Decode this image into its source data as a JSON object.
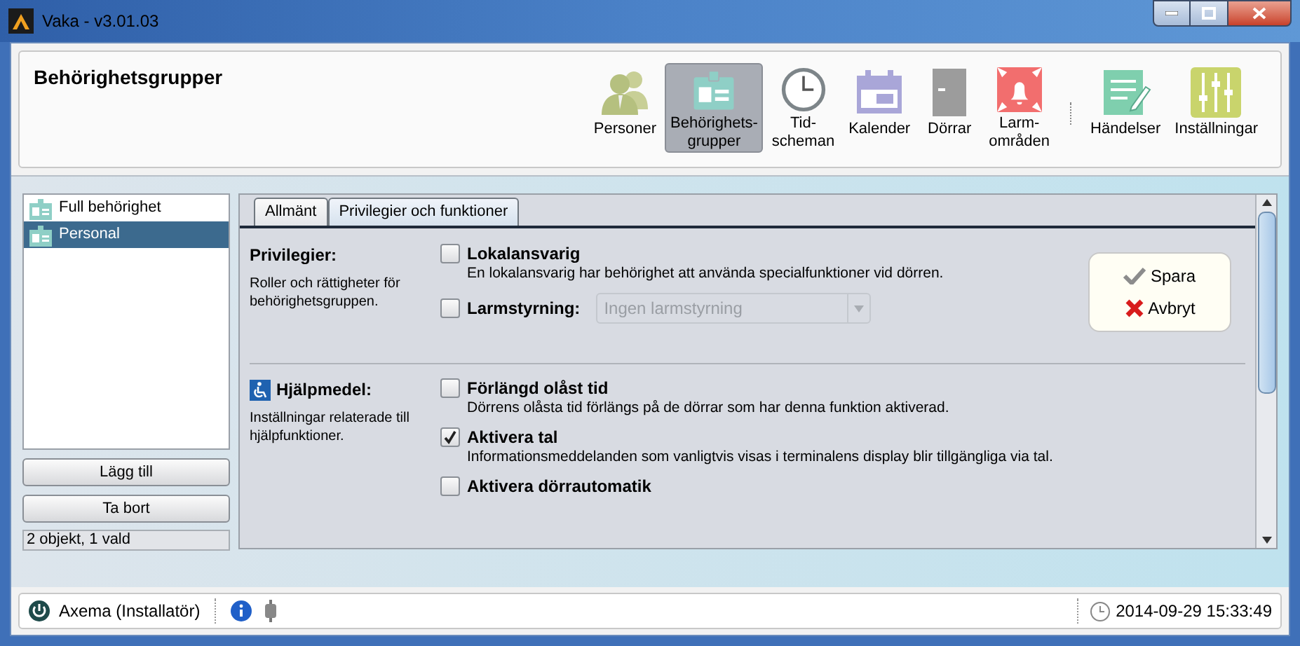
{
  "window": {
    "title": "Vaka - v3.01.03"
  },
  "header": {
    "title": "Behörighetsgrupper",
    "toolbar_groups": [
      [
        {
          "kind": "people",
          "lines": [
            "Personer"
          ],
          "selected": false
        },
        {
          "kind": "badge",
          "lines": [
            "Behörighets-",
            "grupper"
          ],
          "selected": true
        },
        {
          "kind": "clock",
          "lines": [
            "Tid-",
            "scheman"
          ],
          "selected": false
        },
        {
          "kind": "calendar",
          "lines": [
            "Kalender"
          ],
          "selected": false
        },
        {
          "kind": "door",
          "lines": [
            "Dörrar"
          ],
          "selected": false
        },
        {
          "kind": "alarm",
          "lines": [
            "Larm-",
            "områden"
          ],
          "selected": false
        }
      ],
      [
        {
          "kind": "edit",
          "lines": [
            "Händelser"
          ],
          "selected": false
        },
        {
          "kind": "sliders",
          "lines": [
            "Inställningar"
          ],
          "selected": false
        }
      ]
    ]
  },
  "group_list": {
    "items": [
      {
        "label": "Full behörighet",
        "selected": false
      },
      {
        "label": "Personal",
        "selected": true
      }
    ],
    "buttons": [
      "Lägg till",
      "Ta bort"
    ],
    "status": "2 objekt, 1 vald"
  },
  "tabs": [
    {
      "label": "Allmänt",
      "selected": false
    },
    {
      "label": "Privilegier och funktioner",
      "selected": true
    }
  ],
  "sections": [
    {
      "kind": "plain",
      "title": "Privilegier:",
      "description": "Roller och rättigheter för behörighetsgruppen.",
      "options": [
        {
          "kind": "checkbox",
          "label": "Lokalansvarig",
          "checked": false,
          "description": "En lokalansvarig har behörighet att använda specialfunktioner vid dörren."
        },
        {
          "kind": "dropdown",
          "label": "Larmstyrning:",
          "checked": false,
          "value": "Ingen larmstyrning",
          "disabled": true
        }
      ]
    },
    {
      "kind": "accessibility",
      "title": "Hjälpmedel:",
      "description": "Inställningar relaterade till hjälpfunktioner.",
      "options": [
        {
          "kind": "checkbox",
          "label": "Förlängd olåst tid",
          "checked": false,
          "description": "Dörrens olåsta tid förlängs på de dörrar som har denna funktion aktiverad."
        },
        {
          "kind": "checkbox",
          "label": "Aktivera tal",
          "checked": true,
          "description": "Informationsmeddelanden som vanligtvis visas i terminalens display blir tillgängliga via tal."
        },
        {
          "kind": "checkbox",
          "label": "Aktivera dörrautomatik",
          "checked": false
        }
      ]
    }
  ],
  "actions": {
    "save": "Spara",
    "cancel": "Avbryt"
  },
  "status_bar": {
    "user": "Axema (Installatör)",
    "datetime": "2014-09-29 15:33:49"
  }
}
